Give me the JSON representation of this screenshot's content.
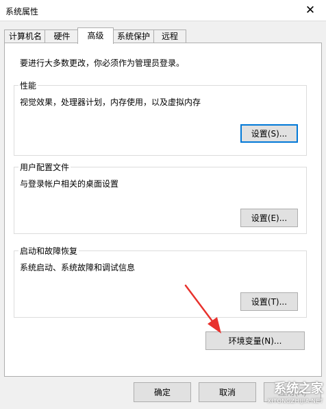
{
  "window": {
    "title": "系统属性",
    "close_glyph": "✕"
  },
  "tabs": [
    {
      "label": "计算机名",
      "active": false
    },
    {
      "label": "硬件",
      "active": false
    },
    {
      "label": "高级",
      "active": true
    },
    {
      "label": "系统保护",
      "active": false
    },
    {
      "label": "远程",
      "active": false
    }
  ],
  "advanced": {
    "admin_note": "要进行大多数更改，你必须作为管理员登录。",
    "performance": {
      "title": "性能",
      "description": "视觉效果，处理器计划，内存使用，以及虚拟内存",
      "settings_label": "设置(S)..."
    },
    "user_profiles": {
      "title": "用户配置文件",
      "description": "与登录帐户相关的桌面设置",
      "settings_label": "设置(E)..."
    },
    "startup_recovery": {
      "title": "启动和故障恢复",
      "description": "系统启动、系统故障和调试信息",
      "settings_label": "设置(T)..."
    },
    "env_vars_label": "环境变量(N)..."
  },
  "footer": {
    "ok_label": "确定",
    "cancel_label": "取消",
    "apply_label": "应用(A)"
  },
  "watermark": {
    "brand": "系统之家",
    "url": "XITONGZHIJIA.NET"
  },
  "colors": {
    "focus_border": "#0078d7",
    "arrow": "#e8322d"
  }
}
